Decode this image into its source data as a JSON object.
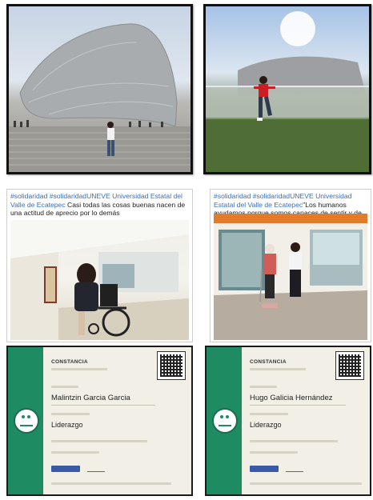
{
  "photo1": {
    "alt_icon": "photo-icon"
  },
  "photo2": {
    "alt_icon": "photo-icon"
  },
  "post1": {
    "caption_tags": "#solidaridad  #solidaridadUNEVE Universidad Estatal del Valle de Ecatepec",
    "caption_text": " Casi todas las cosas buenas nacen de una actitud de aprecio por lo demás"
  },
  "post2": {
    "caption_tags": "#solidaridad #solidaridadUNEVE Universidad Estatal del Valle de Ecatepec",
    "caption_text": "\"Los humanos ayudamos porque somos capaces de sentir y de ponernos en la piel de los demás."
  },
  "cert1": {
    "title": "CONSTANCIA",
    "name": "Malintzin Garcia Garcia",
    "course": "Liderazgo"
  },
  "cert2": {
    "title": "CONSTANCIA",
    "name": "Hugo Galicia Hernández",
    "course": "Liderazgo"
  },
  "colors": {
    "cert_band": "#1f8b63",
    "hashtag": "#3a6fb6",
    "frame": "#111111"
  }
}
